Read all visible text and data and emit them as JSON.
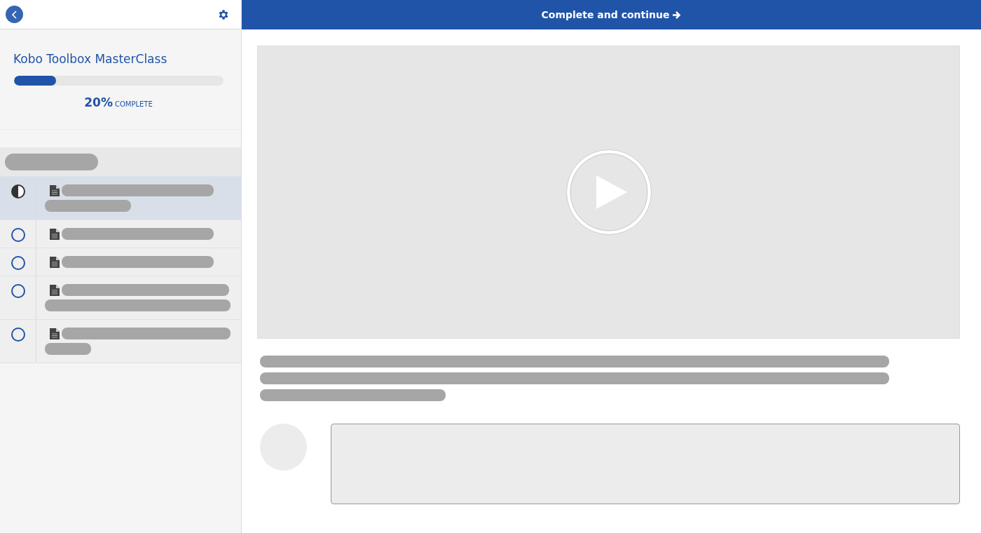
{
  "sidebar": {
    "course": {
      "title": "Kobo Toolbox MasterClass",
      "progress": {
        "level": 0.2,
        "percent": "20%",
        "label": "COMPLETE"
      }
    },
    "lessons": [
      {
        "kind": "partial",
        "selected": true
      },
      {
        "kind": "open",
        "selected": false
      },
      {
        "kind": "open",
        "selected": false
      },
      {
        "kind": "open",
        "selected": false
      },
      {
        "kind": "open",
        "selected": false
      }
    ]
  },
  "header": {
    "button": "Complete and continue"
  }
}
